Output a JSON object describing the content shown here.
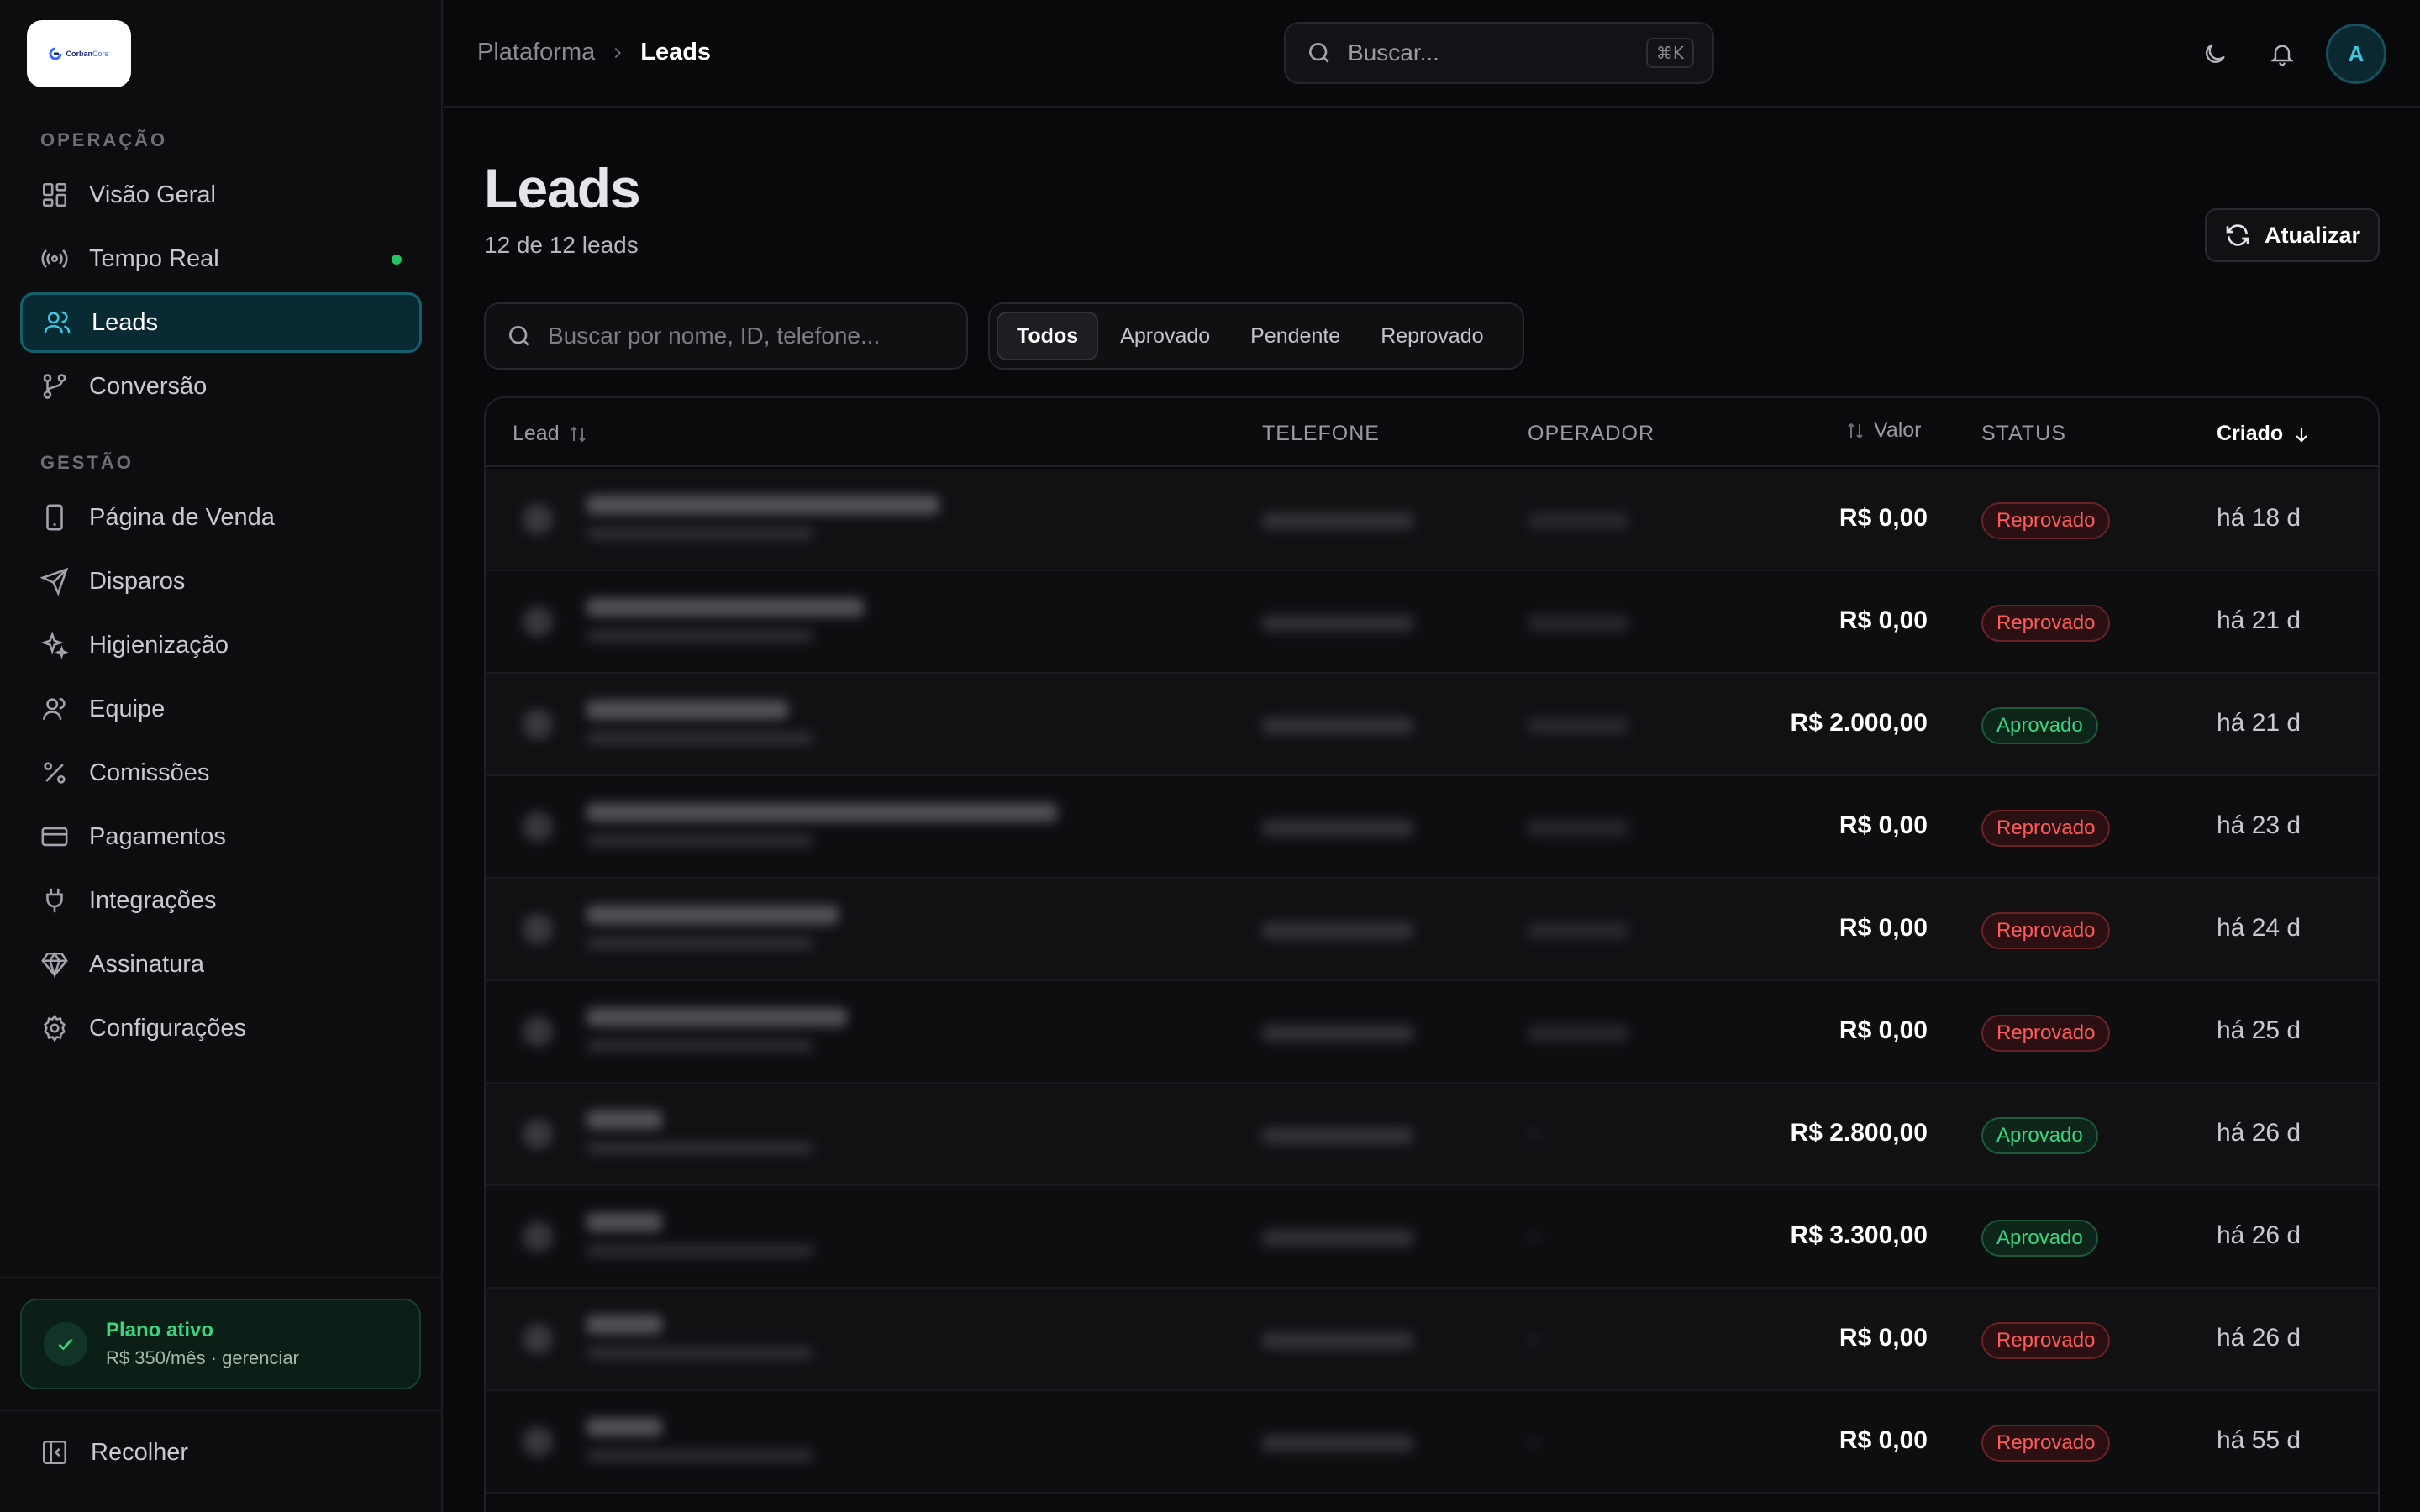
{
  "logo": {
    "text_primary": "Corban",
    "text_secondary": "Core"
  },
  "sidebar": {
    "section_operacao": "OPERAÇÃO",
    "section_gestao": "GESTÃO",
    "items": [
      {
        "label": "Visão Geral",
        "icon": "grid-icon"
      },
      {
        "label": "Tempo Real",
        "icon": "broadcast-icon",
        "live": true
      },
      {
        "label": "Leads",
        "icon": "users-icon",
        "active": true
      },
      {
        "label": "Conversão",
        "icon": "git-branch-icon"
      },
      {
        "label": "Página de Venda",
        "icon": "smartphone-icon"
      },
      {
        "label": "Disparos",
        "icon": "send-icon"
      },
      {
        "label": "Higienização",
        "icon": "sparkles-icon"
      },
      {
        "label": "Equipe",
        "icon": "user-icon"
      },
      {
        "label": "Comissões",
        "icon": "percent-icon"
      },
      {
        "label": "Pagamentos",
        "icon": "credit-card-icon"
      },
      {
        "label": "Integrações",
        "icon": "plug-icon"
      },
      {
        "label": "Assinatura",
        "icon": "diamond-icon"
      },
      {
        "label": "Configurações",
        "icon": "gear-icon"
      }
    ],
    "plan": {
      "title": "Plano ativo",
      "subtitle": "R$ 350/mês · gerenciar"
    },
    "collapse_label": "Recolher"
  },
  "topbar": {
    "breadcrumb": [
      "Plataforma",
      "Leads"
    ],
    "search_placeholder": "Buscar...",
    "search_shortcut": "⌘K",
    "avatar_initial": "A"
  },
  "main": {
    "title": "Leads",
    "subtitle": "12 de 12 leads",
    "refresh_label": "Atualizar",
    "search_placeholder": "Buscar por nome, ID, telefone...",
    "filters": [
      {
        "label": "Todos",
        "active": true
      },
      {
        "label": "Aprovado"
      },
      {
        "label": "Pendente"
      },
      {
        "label": "Reprovado"
      }
    ],
    "table": {
      "columns": {
        "lead": "Lead",
        "telefone": "TELEFONE",
        "operador": "OPERADOR",
        "valor": "Valor",
        "status": "STATUS",
        "criado": "Criado"
      },
      "rows": [
        {
          "valor": "R$ 0,00",
          "status": "Reprovado",
          "status_kind": "rejected",
          "criado": "há 18 d"
        },
        {
          "valor": "R$ 0,00",
          "status": "Reprovado",
          "status_kind": "rejected",
          "criado": "há 21 d"
        },
        {
          "valor": "R$ 2.000,00",
          "status": "Aprovado",
          "status_kind": "approved",
          "criado": "há 21 d"
        },
        {
          "valor": "R$ 0,00",
          "status": "Reprovado",
          "status_kind": "rejected",
          "criado": "há 23 d"
        },
        {
          "valor": "R$ 0,00",
          "status": "Reprovado",
          "status_kind": "rejected",
          "criado": "há 24 d"
        },
        {
          "valor": "R$ 0,00",
          "status": "Reprovado",
          "status_kind": "rejected",
          "criado": "há 25 d"
        },
        {
          "valor": "R$ 2.800,00",
          "status": "Aprovado",
          "status_kind": "approved",
          "criado": "há 26 d"
        },
        {
          "valor": "R$ 3.300,00",
          "status": "Aprovado",
          "status_kind": "approved",
          "criado": "há 26 d"
        },
        {
          "valor": "R$ 0,00",
          "status": "Reprovado",
          "status_kind": "rejected",
          "criado": "há 26 d"
        },
        {
          "valor": "R$ 0,00",
          "status": "Reprovado",
          "status_kind": "rejected",
          "criado": "há 55 d"
        }
      ]
    }
  },
  "colors": {
    "accent": "#3cc6e0",
    "approved": "#3bd47f",
    "rejected": "#ff5b5b",
    "live_dot": "#22c55e"
  }
}
